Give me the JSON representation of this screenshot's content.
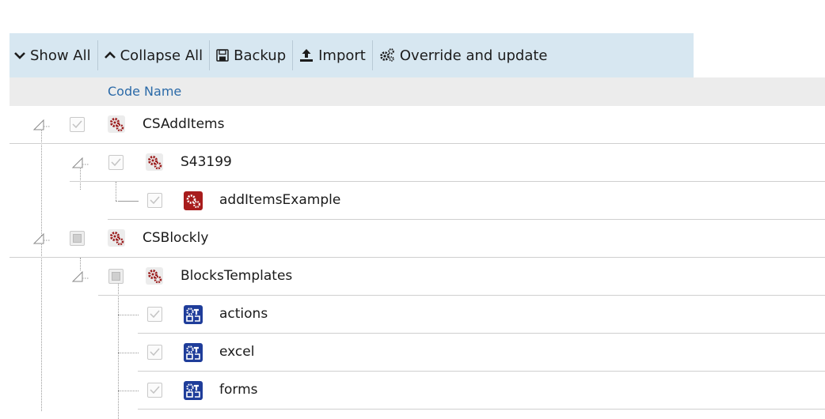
{
  "toolbar": {
    "show_all": "Show All",
    "collapse_all": "Collapse All",
    "backup": "Backup",
    "import": "Import",
    "override": "Override and update"
  },
  "header": {
    "code_name": "Code Name"
  },
  "tree": {
    "nodes": [
      {
        "label": "CSAddItems",
        "icon": "gear-folder-icon",
        "checked": "checked",
        "expanded": true
      },
      {
        "label": "S43199",
        "icon": "gear-folder-icon",
        "checked": "checked",
        "expanded": true
      },
      {
        "label": "addItemsExample",
        "icon": "gear-item-icon",
        "checked": "checked"
      },
      {
        "label": "CSBlockly",
        "icon": "gear-folder-icon",
        "checked": "indeterminate",
        "expanded": true
      },
      {
        "label": "BlocksTemplates",
        "icon": "gear-folder-icon",
        "checked": "indeterminate",
        "expanded": true
      },
      {
        "label": "actions",
        "icon": "template-icon",
        "checked": "checked"
      },
      {
        "label": "excel",
        "icon": "template-icon",
        "checked": "checked"
      },
      {
        "label": "forms",
        "icon": "template-icon",
        "checked": "checked"
      }
    ]
  }
}
